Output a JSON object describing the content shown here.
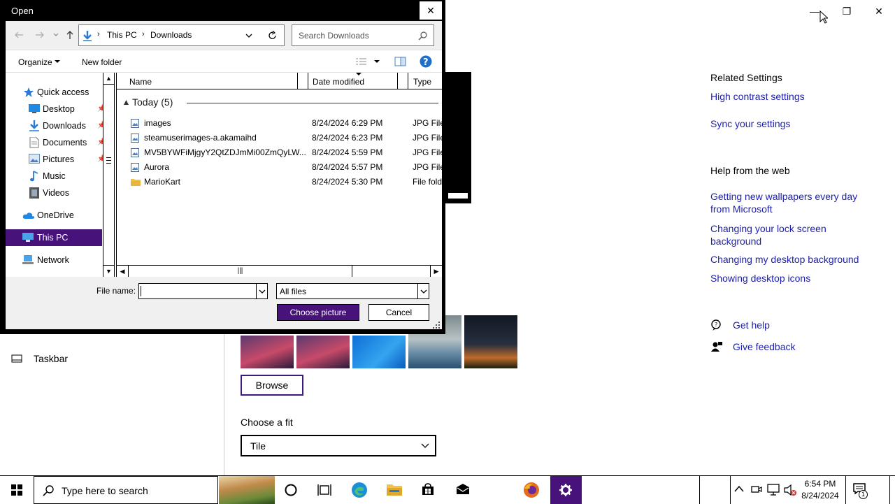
{
  "settings": {
    "taskbar_label": "Taskbar",
    "related_settings_title": "Related Settings",
    "related_links": [
      "High contrast settings",
      "Sync your settings"
    ],
    "help_title": "Help from the web",
    "help_links": [
      "Getting new wallpapers every day from Microsoft",
      "Changing your lock screen background",
      "Changing my desktop background",
      "Showing desktop icons"
    ],
    "get_help": "Get help",
    "give_feedback": "Give feedback",
    "browse_label": "Browse",
    "fit_label": "Choose a fit",
    "fit_value": "Tile",
    "window_controls": [
      "—",
      "❐",
      "✕"
    ]
  },
  "dialog": {
    "title": "Open",
    "breadcrumb": [
      "This PC",
      "Downloads"
    ],
    "search_placeholder": "Search Downloads",
    "organize_label": "Organize",
    "new_folder_label": "New folder",
    "nav": {
      "quick_access": "Quick access",
      "desktop": "Desktop",
      "downloads": "Downloads",
      "documents": "Documents",
      "pictures": "Pictures",
      "music": "Music",
      "videos": "Videos",
      "onedrive": "OneDrive",
      "this_pc": "This PC",
      "network": "Network"
    },
    "columns": [
      "Name",
      "Date modified",
      "Type"
    ],
    "group_label": "Today (5)",
    "files": [
      {
        "name": "images",
        "date": "8/24/2024 6:29 PM",
        "type": "JPG File",
        "icon": "image-file-icon"
      },
      {
        "name": "steamuserimages-a.akamaihd",
        "date": "8/24/2024 6:23 PM",
        "type": "JPG File",
        "icon": "image-file-icon"
      },
      {
        "name": "MV5BYWFiMjgyY2QtZDJmMi00ZmQyLW...",
        "date": "8/24/2024 5:59 PM",
        "type": "JPG File",
        "icon": "image-file-icon"
      },
      {
        "name": "Aurora",
        "date": "8/24/2024 5:57 PM",
        "type": "JPG File",
        "icon": "image-file-icon"
      },
      {
        "name": "MarioKart",
        "date": "8/24/2024 5:30 PM",
        "type": "File folder",
        "icon": "folder-icon"
      }
    ],
    "file_name_label": "File name:",
    "file_name_value": "",
    "file_type_value": "All files",
    "choose_button": "Choose picture",
    "cancel_button": "Cancel"
  },
  "taskbar": {
    "search_placeholder": "Type here to search",
    "time": "6:54 PM",
    "date": "8/24/2024",
    "notification_count": "1"
  },
  "colors": {
    "accent": "#3c1a80",
    "link": "#1b1eae",
    "selected_nav": "#47127a"
  }
}
